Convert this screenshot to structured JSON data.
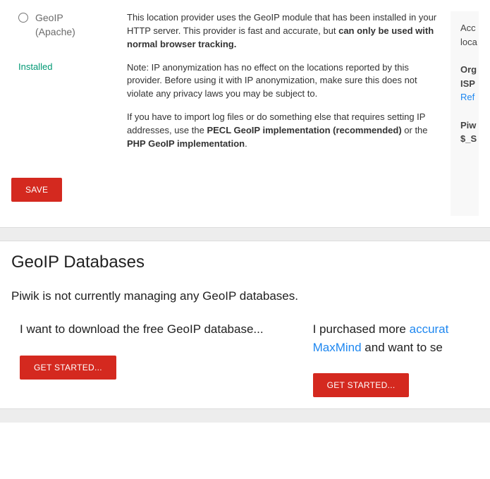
{
  "provider": {
    "name_line1": "GeoIP",
    "name_line2": "(Apache)",
    "installed_label": "Installed",
    "desc_p1_a": "This location provider uses the GeoIP module that has been installed in your HTTP server. This provider is fast and accurate, but ",
    "desc_p1_b": "can only be used with normal browser tracking.",
    "desc_p2": "Note: IP anonymization has no effect on the locations reported by this provider. Before using it with IP anonymization, make sure this does not violate any privacy laws you may be subject to.",
    "desc_p3_a": "If you have to import log files or do something else that requires setting IP addresses, use the ",
    "desc_p3_b": "PECL GeoIP implementation (recommended)",
    "desc_p3_c": " or the ",
    "desc_p3_d": "PHP GeoIP implementation",
    "desc_p3_e": "."
  },
  "side": {
    "b1_l1": "Acc",
    "b1_l2": "loca",
    "b2_l1": "Org",
    "b2_l2": "ISP",
    "b2_link": "Ref",
    "b3_l1": "Piw",
    "b3_l2": "$_S"
  },
  "buttons": {
    "save": "SAVE",
    "get_started": "GET STARTED..."
  },
  "geoip_db": {
    "title": "GeoIP Databases",
    "status": "Piwik is not currently managing any GeoIP databases.",
    "col1_title": "I want to download the free GeoIP database...",
    "col2_a": "I purchased more ",
    "col2_link1": "accurat",
    "col2_b": " ",
    "col2_link2": "MaxMind",
    "col2_c": " and want to se"
  }
}
